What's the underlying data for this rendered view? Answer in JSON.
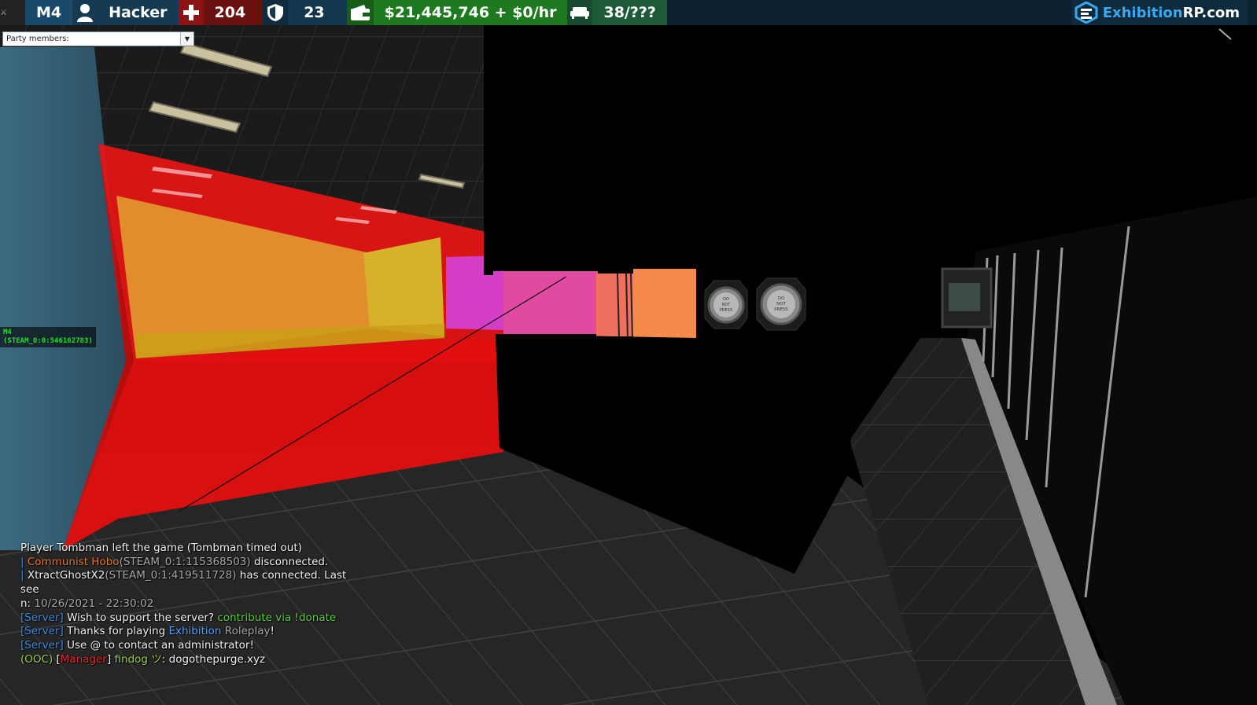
{
  "hud": {
    "weapon": "M4",
    "job": "Hacker",
    "health": "204",
    "armor": "23",
    "money": "$21,445,746 + $0/hr",
    "seats": "38/???",
    "colors": {
      "bg": "#0c2233",
      "health": "#6b1010",
      "armor": "#13374d",
      "money": "#1e7a1e",
      "seats": "#1d5a3a"
    }
  },
  "logo": {
    "main": "Exhibition",
    "suffix": "RP.com"
  },
  "party": {
    "label": "Party members:"
  },
  "player_tag": {
    "name": "M4",
    "steam": "(STEAM_0:0:546162783)"
  },
  "scene": {
    "button_text_1": "DO\nNOT\nPRESS",
    "button_text_2": "DO\nNOT\nPRESS"
  },
  "chat": {
    "l1": "Player Tombman left the game (Tombman timed out)",
    "l2_bar": "| ",
    "l2_name": "Communist Hobo",
    "l2_id": "(STEAM_0:1:115368503)",
    "l2_rest": " disconnected.",
    "l3_bar": "| ",
    "l3_name": "XtractGhostX2",
    "l3_id": "(STEAM_0:1:419511728)",
    "l3_rest": " has connected. Last see",
    "l4_pre": "n: ",
    "l4_date": "10/26/2021 - 22:30:02",
    "server_tag": "[Server]",
    "l5_text": " Wish to support the server? ",
    "l5_link": "contribute via !donate",
    "l6_text": " Thanks for playing ",
    "l6_ex": "Exhibition",
    "l6_rp": " Roleplay",
    "l6_end": "!",
    "l7_text": " Use @ to contact an administrator!",
    "l8_ooc": "(OOC)",
    "l8_open": " [",
    "l8_rank": "Manager",
    "l8_close": "] ",
    "l8_name": "findog ツ",
    "l8_msg": ": dogothepurge.xyz"
  }
}
